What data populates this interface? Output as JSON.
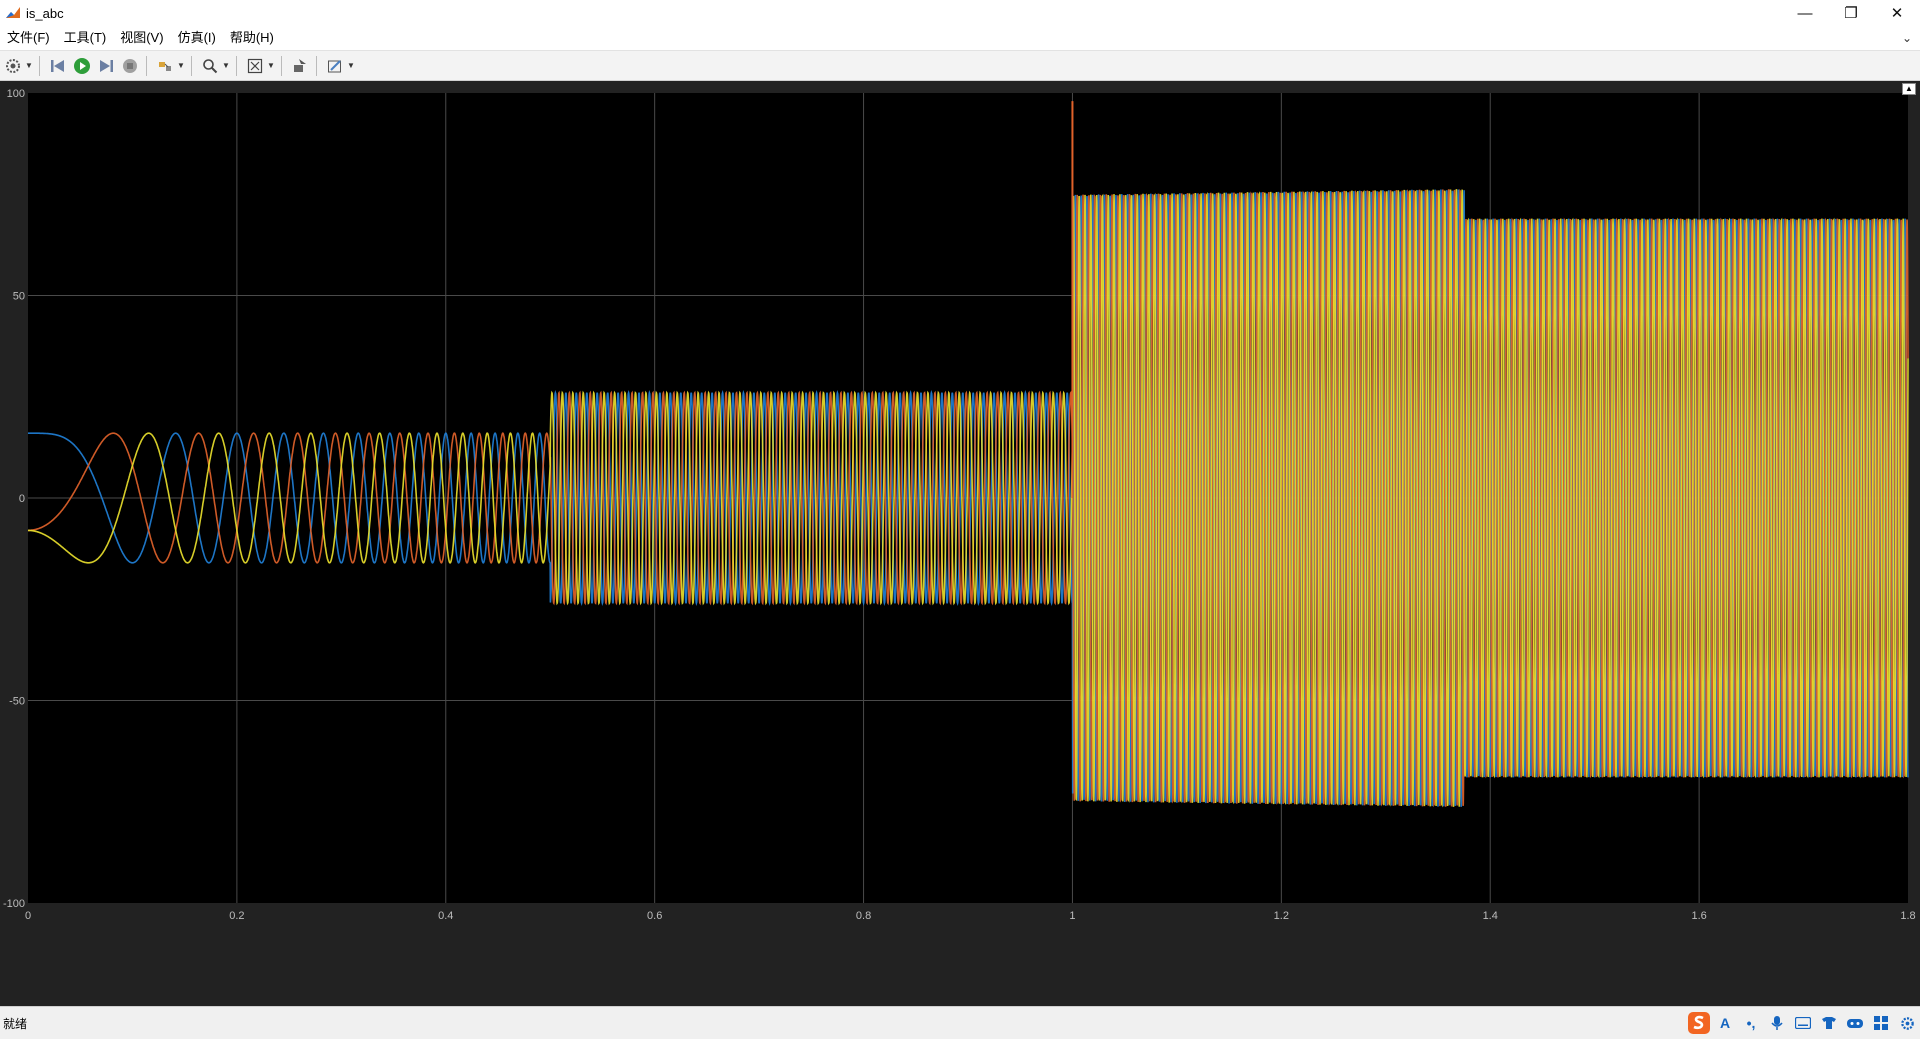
{
  "window": {
    "title": "is_abc",
    "controls": {
      "minimize": "—",
      "restore": "❐",
      "close": "✕"
    }
  },
  "menu": {
    "items": [
      {
        "label": "文件(F)"
      },
      {
        "label": "工具(T)"
      },
      {
        "label": "视图(V)"
      },
      {
        "label": "仿真(I)"
      },
      {
        "label": "帮助(H)"
      }
    ]
  },
  "toolbar": {
    "buttons": [
      {
        "icon": "settings-gear-icon"
      },
      {
        "icon": "step-back-icon"
      },
      {
        "icon": "run-icon"
      },
      {
        "icon": "step-forward-icon"
      },
      {
        "icon": "stop-icon"
      },
      {
        "icon": "highlight-block-icon"
      },
      {
        "icon": "zoom-icon"
      },
      {
        "icon": "autoscale-icon"
      },
      {
        "icon": "write-icon"
      },
      {
        "icon": "style-icon"
      }
    ]
  },
  "status": {
    "text": "就绪"
  },
  "colors": {
    "axes_bg": "#000000",
    "figure_bg": "#222222",
    "grid": "#4a4a4a",
    "tick_text": "#bdbdbd",
    "series_blue": "#1f7fd6",
    "series_orange": "#e0622a",
    "series_yellow": "#e8de2c"
  },
  "chart_data": {
    "type": "line",
    "title": "",
    "xlabel": "",
    "ylabel": "",
    "xlim": [
      0,
      1.8
    ],
    "ylim": [
      -100,
      100
    ],
    "grid": true,
    "x_ticks": [
      "0",
      "0.2",
      "0.4",
      "0.6",
      "0.8",
      "1",
      "1.2",
      "1.4",
      "1.6",
      "1.8"
    ],
    "y_ticks": [
      "100",
      "50",
      "0",
      "-50",
      "-100"
    ],
    "series": [
      {
        "color": "#1f7fd6",
        "phase_deg": 90
      },
      {
        "color": "#e0622a",
        "phase_deg": -30
      },
      {
        "color": "#e8de2c",
        "phase_deg": 210
      }
    ],
    "segments": [
      {
        "t_start": 0.0,
        "t_end": 0.5,
        "amplitude": 16,
        "freq_start_hz": 0,
        "freq_end_hz": 50
      },
      {
        "t_start": 0.5,
        "t_end": 1.0,
        "amplitude": 26,
        "freq_hz": 100
      },
      {
        "t_start": 1.0,
        "t_end": 1.375,
        "amplitude": 76,
        "freq_hz": 180
      },
      {
        "t_start": 1.375,
        "t_end": 1.8,
        "amplitude": 69,
        "freq_hz": 180
      }
    ],
    "transient_peak": {
      "t": 1.0,
      "value": 98
    }
  }
}
